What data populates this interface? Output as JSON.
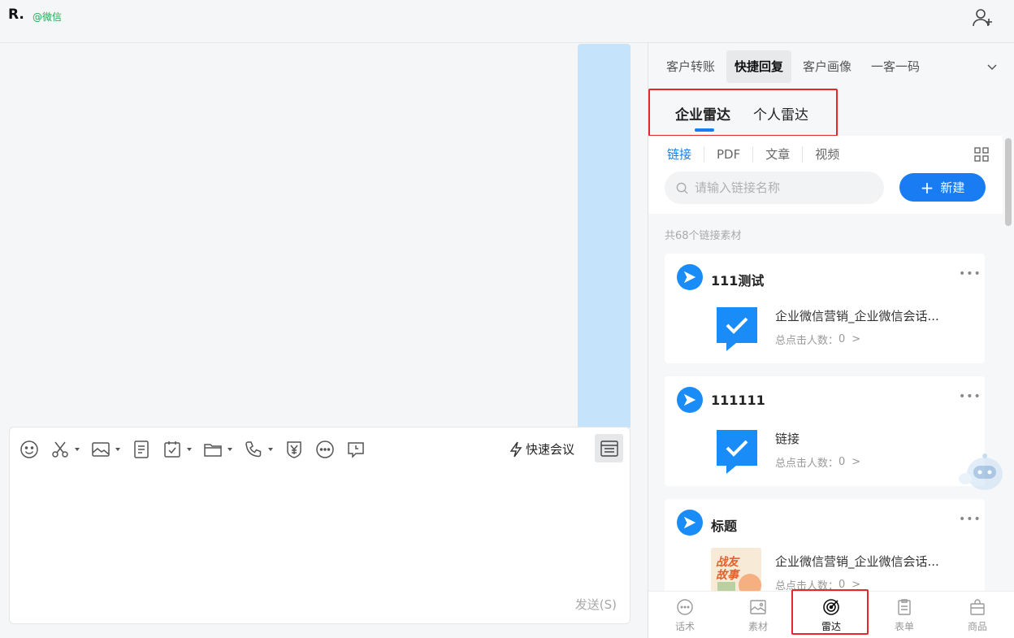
{
  "header": {
    "chat_name": "R.",
    "chat_tag": "@微信"
  },
  "composer": {
    "quick_meeting_label": "快速会议",
    "send_label": "发送(S)"
  },
  "sidebar": {
    "tabs": [
      {
        "label": "客户转账",
        "active": false
      },
      {
        "label": "快捷回复",
        "active": true
      },
      {
        "label": "客户画像",
        "active": false
      },
      {
        "label": "一客一码",
        "active": false
      }
    ],
    "radar_tabs": [
      {
        "label": "企业雷达",
        "active": true
      },
      {
        "label": "个人雷达",
        "active": false
      }
    ],
    "type_tabs": [
      "链接",
      "PDF",
      "文章",
      "视频"
    ],
    "search_placeholder": "请输入链接名称",
    "new_button_label": "新建",
    "count_text": "共68个链接素材",
    "items": [
      {
        "title": "111测试",
        "desc": "企业微信营销_企业微信会话...",
        "clicks_label": "总点击人数：",
        "clicks": "0"
      },
      {
        "title": "111111",
        "desc": "链接",
        "clicks_label": "总点击人数：",
        "clicks": "0"
      },
      {
        "title": "标题",
        "desc": "企业微信营销_企业微信会话...",
        "clicks_label": "总点击人数：",
        "clicks": "0",
        "thumb_text": "战友故事"
      }
    ],
    "bottom_nav": [
      {
        "label": "话术",
        "icon": "chat-dots-icon",
        "active": false
      },
      {
        "label": "素材",
        "icon": "image-icon",
        "active": false
      },
      {
        "label": "雷达",
        "icon": "radar-icon",
        "active": true
      },
      {
        "label": "表单",
        "icon": "form-icon",
        "active": false
      },
      {
        "label": "商品",
        "icon": "bag-icon",
        "active": false
      }
    ]
  },
  "colors": {
    "accent": "#1a7cf2",
    "highlight_box": "#e8262b",
    "tag_green": "#1fae53"
  }
}
